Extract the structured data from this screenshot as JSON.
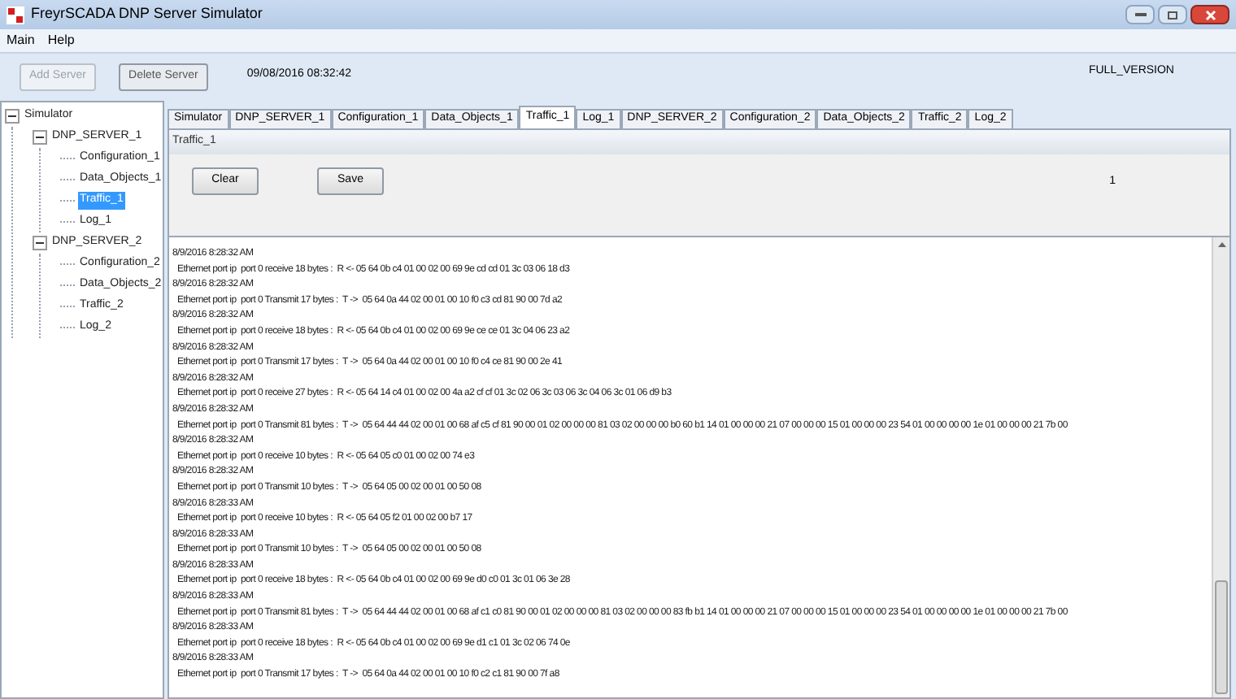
{
  "window": {
    "title": "FreyrSCADA DNP Server Simulator"
  },
  "menu": [
    "Main",
    "Help"
  ],
  "toolbar": {
    "buttons": [
      {
        "label": "Add Server",
        "disabled": true
      },
      {
        "label": "Delete Server",
        "disabled": false
      }
    ],
    "datetime": "09/08/2016 08:32:42",
    "edition": "FULL_VERSION"
  },
  "tree": [
    {
      "label": "Simulator",
      "expanded": true,
      "selected": false,
      "children": [
        {
          "label": "DNP_SERVER_1",
          "expanded": true,
          "selected": false,
          "children": [
            {
              "label": "Configuration_1",
              "selected": false
            },
            {
              "label": "Data_Objects_1",
              "selected": false
            },
            {
              "label": "Traffic_1",
              "selected": true
            },
            {
              "label": "Log_1",
              "selected": false
            }
          ]
        },
        {
          "label": "DNP_SERVER_2",
          "expanded": true,
          "selected": false,
          "children": [
            {
              "label": "Configuration_2",
              "selected": false
            },
            {
              "label": "Data_Objects_2",
              "selected": false
            },
            {
              "label": "Traffic_2",
              "selected": false
            },
            {
              "label": "Log_2",
              "selected": false
            }
          ]
        }
      ]
    }
  ],
  "tabs": [
    {
      "label": "Simulator",
      "selected": false
    },
    {
      "label": "DNP_SERVER_1",
      "selected": false
    },
    {
      "label": "Configuration_1",
      "selected": false
    },
    {
      "label": "Data_Objects_1",
      "selected": false
    },
    {
      "label": "Traffic_1",
      "selected": true
    },
    {
      "label": "Log_1",
      "selected": false
    },
    {
      "label": "DNP_SERVER_2",
      "selected": false
    },
    {
      "label": "Configuration_2",
      "selected": false
    },
    {
      "label": "Data_Objects_2",
      "selected": false
    },
    {
      "label": "Traffic_2",
      "selected": false
    },
    {
      "label": "Log_2",
      "selected": false
    }
  ],
  "panel": {
    "title": "Traffic_1",
    "buttons": [
      "Clear",
      "Save"
    ],
    "count": "1"
  },
  "log": [
    {
      "time": "8/9/2016 8:28:32 AM",
      "message": "Ethernet port ip  port 0 receive 18 bytes :  R <- 05 64 0b c4 01 00 02 00 69 9e cd cd 01 3c 03 06 18 d3"
    },
    {
      "time": "8/9/2016 8:28:32 AM",
      "message": "Ethernet port ip  port 0 Transmit 17 bytes :  T ->  05 64 0a 44 02 00 01 00 10 f0 c3 cd 81 90 00 7d a2"
    },
    {
      "time": "8/9/2016 8:28:32 AM",
      "message": "Ethernet port ip  port 0 receive 18 bytes :  R <- 05 64 0b c4 01 00 02 00 69 9e ce ce 01 3c 04 06 23 a2"
    },
    {
      "time": "8/9/2016 8:28:32 AM",
      "message": "Ethernet port ip  port 0 Transmit 17 bytes :  T ->  05 64 0a 44 02 00 01 00 10 f0 c4 ce 81 90 00 2e 41"
    },
    {
      "time": "8/9/2016 8:28:32 AM",
      "message": "Ethernet port ip  port 0 receive 27 bytes :  R <- 05 64 14 c4 01 00 02 00 4a a2 cf cf 01 3c 02 06 3c 03 06 3c 04 06 3c 01 06 d9 b3"
    },
    {
      "time": "8/9/2016 8:28:32 AM",
      "message": "Ethernet port ip  port 0 Transmit 81 bytes :  T ->  05 64 44 44 02 00 01 00 68 af c5 cf 81 90 00 01 02 00 00 00 81 03 02 00 00 00 b0 60 b1 14 01 00 00 00 21 07 00 00 00 15 01 00 00 00 23 54 01 00 00 00 00 1e 01 00 00 00 21 7b 00"
    },
    {
      "time": "8/9/2016 8:28:32 AM",
      "message": "Ethernet port ip  port 0 receive 10 bytes :  R <- 05 64 05 c0 01 00 02 00 74 e3"
    },
    {
      "time": "8/9/2016 8:28:32 AM",
      "message": "Ethernet port ip  port 0 Transmit 10 bytes :  T ->  05 64 05 00 02 00 01 00 50 08"
    },
    {
      "time": "8/9/2016 8:28:33 AM",
      "message": "Ethernet port ip  port 0 receive 10 bytes :  R <- 05 64 05 f2 01 00 02 00 b7 17"
    },
    {
      "time": "8/9/2016 8:28:33 AM",
      "message": "Ethernet port ip  port 0 Transmit 10 bytes :  T ->  05 64 05 00 02 00 01 00 50 08"
    },
    {
      "time": "8/9/2016 8:28:33 AM",
      "message": "Ethernet port ip  port 0 receive 18 bytes :  R <- 05 64 0b c4 01 00 02 00 69 9e d0 c0 01 3c 01 06 3e 28"
    },
    {
      "time": "8/9/2016 8:28:33 AM",
      "message": "Ethernet port ip  port 0 Transmit 81 bytes :  T ->  05 64 44 44 02 00 01 00 68 af c1 c0 81 90 00 01 02 00 00 00 81 03 02 00 00 00 83 fb b1 14 01 00 00 00 21 07 00 00 00 15 01 00 00 00 23 54 01 00 00 00 00 1e 01 00 00 00 21 7b 00"
    },
    {
      "time": "8/9/2016 8:28:33 AM",
      "message": "Ethernet port ip  port 0 receive 18 bytes :  R <- 05 64 0b c4 01 00 02 00 69 9e d1 c1 01 3c 02 06 74 0e"
    },
    {
      "time": "8/9/2016 8:28:33 AM",
      "message": "Ethernet port ip  port 0 Transmit 17 bytes :  T ->  05 64 0a 44 02 00 01 00 10 f0 c2 c1 81 90 00 7f a8"
    }
  ]
}
